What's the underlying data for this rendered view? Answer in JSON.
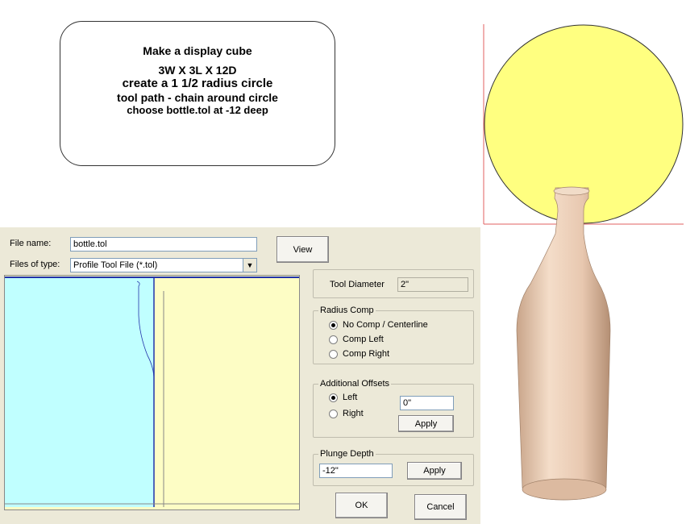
{
  "instructions": {
    "lines": [
      "Make a display cube",
      "3W X 3L X 12D",
      "create a 1 1/2 radius circle",
      "tool path - chain around circle",
      "choose bottle.tol at -12 deep"
    ]
  },
  "dialog": {
    "file_name_label": "File name:",
    "file_name_value": "bottle.tol",
    "files_of_type_label": "Files of type:",
    "files_of_type_value": "Profile Tool File (*.tol)",
    "view_button": "View",
    "tool_diameter_label": "Tool Diameter",
    "tool_diameter_value": "2\"",
    "radius_comp": {
      "title": "Radius Comp",
      "options": [
        "No Comp / Centerline",
        "Comp Left",
        "Comp Right"
      ],
      "selected": "No Comp / Centerline"
    },
    "additional_offsets": {
      "title": "Additional Offsets",
      "options": [
        "Left",
        "Right"
      ],
      "selected": "Left",
      "value": "0\"",
      "apply_button": "Apply"
    },
    "plunge_depth": {
      "title": "Plunge Depth",
      "value": "-12\"",
      "apply_button": "Apply"
    },
    "ok_button": "OK",
    "cancel_button": "Cancel"
  },
  "colors": {
    "preview_cyan": "#c0ffff",
    "preview_yellow": "#fdfdc5",
    "profile_line": "#2233aa",
    "circle_fill": "#ffff80",
    "bottle": "#e8c8b0",
    "axis_red": "#e06060"
  }
}
